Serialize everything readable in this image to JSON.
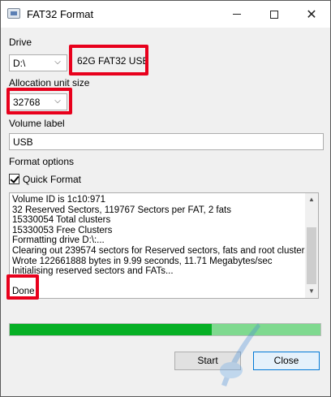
{
  "window": {
    "title": "FAT32 Format",
    "title_icon": "drive-format-icon"
  },
  "drive": {
    "label": "Drive",
    "selected": "D:\\",
    "name": "62G FAT32 USB"
  },
  "allocation": {
    "label": "Allocation unit size",
    "selected": "32768"
  },
  "volume": {
    "label": "Volume label",
    "value": "USB"
  },
  "format_options": {
    "label": "Format options",
    "quick_format_label": "Quick Format",
    "quick_format_checked": true
  },
  "log": {
    "lines": [
      "Volume ID is 1c10:971",
      "32 Reserved Sectors, 119767 Sectors per FAT, 2 fats",
      "15330054 Total clusters",
      "15330053 Free Clusters",
      "Formatting drive D:\\:...",
      "Clearing out 239574 sectors for Reserved sectors, fats and root cluster...",
      "Wrote 122661888 bytes in 9.99 seconds, 11.71 Megabytes/sec",
      "Initialising reserved sectors and FATs...",
      "",
      "Done"
    ]
  },
  "progress": {
    "fraction": 0.65,
    "color": "#06b025"
  },
  "buttons": {
    "start": "Start",
    "close": "Close"
  },
  "colors": {
    "highlight": "#e8001c",
    "accent": "#0078d7"
  }
}
